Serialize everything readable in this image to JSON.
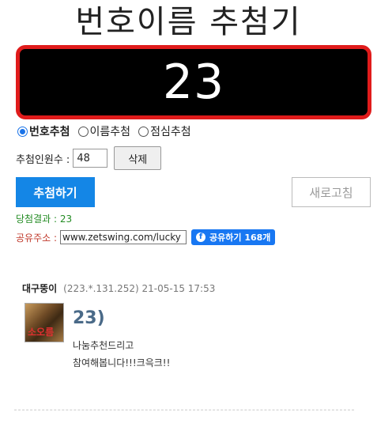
{
  "title": "번호이름 추첨기",
  "display_number": "23",
  "modes": [
    {
      "label": "번호추첨",
      "selected": true
    },
    {
      "label": "이름추첨",
      "selected": false
    },
    {
      "label": "점심추첨",
      "selected": false
    }
  ],
  "count": {
    "label": "추첨인원수 :",
    "value": "48",
    "delete_label": "삭제"
  },
  "buttons": {
    "draw": "추첨하기",
    "refresh": "새로고침"
  },
  "result_text": "당첨결과 : 23",
  "share": {
    "label": "공유주소 :",
    "url": "www.zetswing.com/lucky",
    "fb_label": "공유하기 168개",
    "fb_icon": "facebook-icon"
  },
  "comment": {
    "author": "대구뚱이",
    "meta": "(223.*.131.252) 21-05-15 17:53",
    "avatar_text": "소오름",
    "number": "23)",
    "lines": [
      "나눔추천드리고",
      "참여해봅니다!!!크윽크!!"
    ]
  },
  "colors": {
    "accent_blue": "#1486e6",
    "display_border": "#e01b1b",
    "result_green": "#228b22",
    "share_red": "#c0392b"
  }
}
